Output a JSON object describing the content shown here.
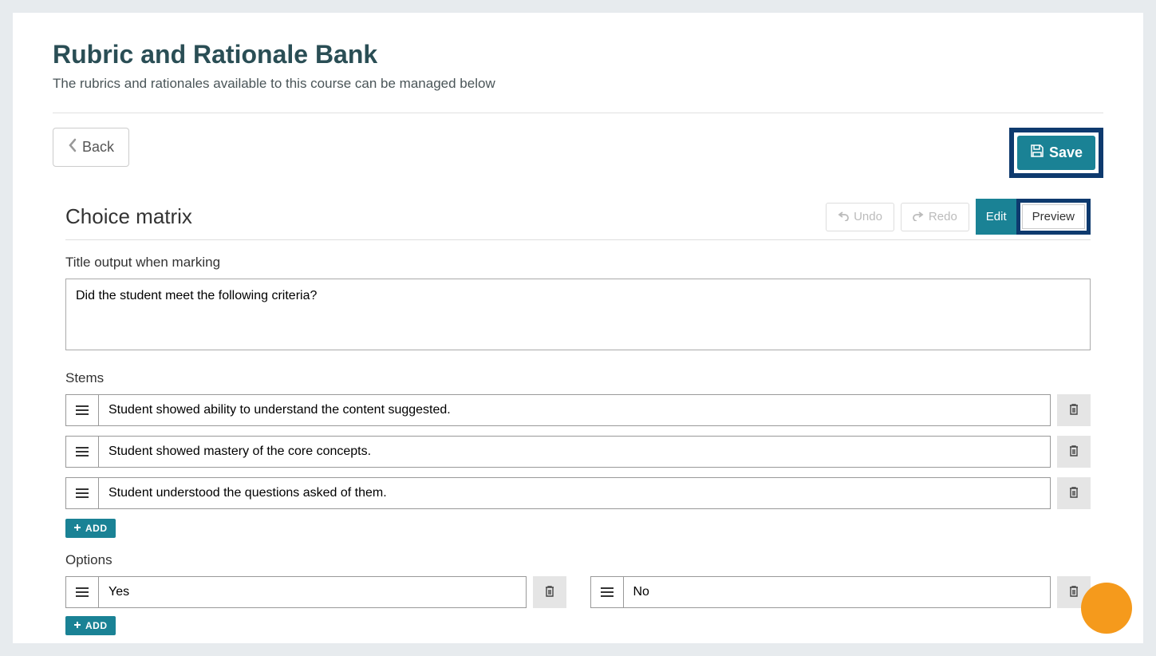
{
  "page": {
    "title": "Rubric and Rationale Bank",
    "subtitle": "The rubrics and rationales available to this course can be managed below"
  },
  "toolbar": {
    "back": "Back",
    "save": "Save"
  },
  "editor": {
    "sectionTitle": "Choice matrix",
    "undo": "Undo",
    "redo": "Redo",
    "edit": "Edit",
    "preview": "Preview",
    "titleLabel": "Title output when marking",
    "titleValue": "Did the student meet the following criteria?",
    "stemsLabel": "Stems",
    "stems": [
      "Student showed ability to understand the content suggested.",
      "Student showed mastery of the core concepts.",
      "Student understood the questions asked of them."
    ],
    "addLabel": "ADD",
    "optionsLabel": "Options",
    "options": [
      "Yes",
      "No"
    ]
  }
}
